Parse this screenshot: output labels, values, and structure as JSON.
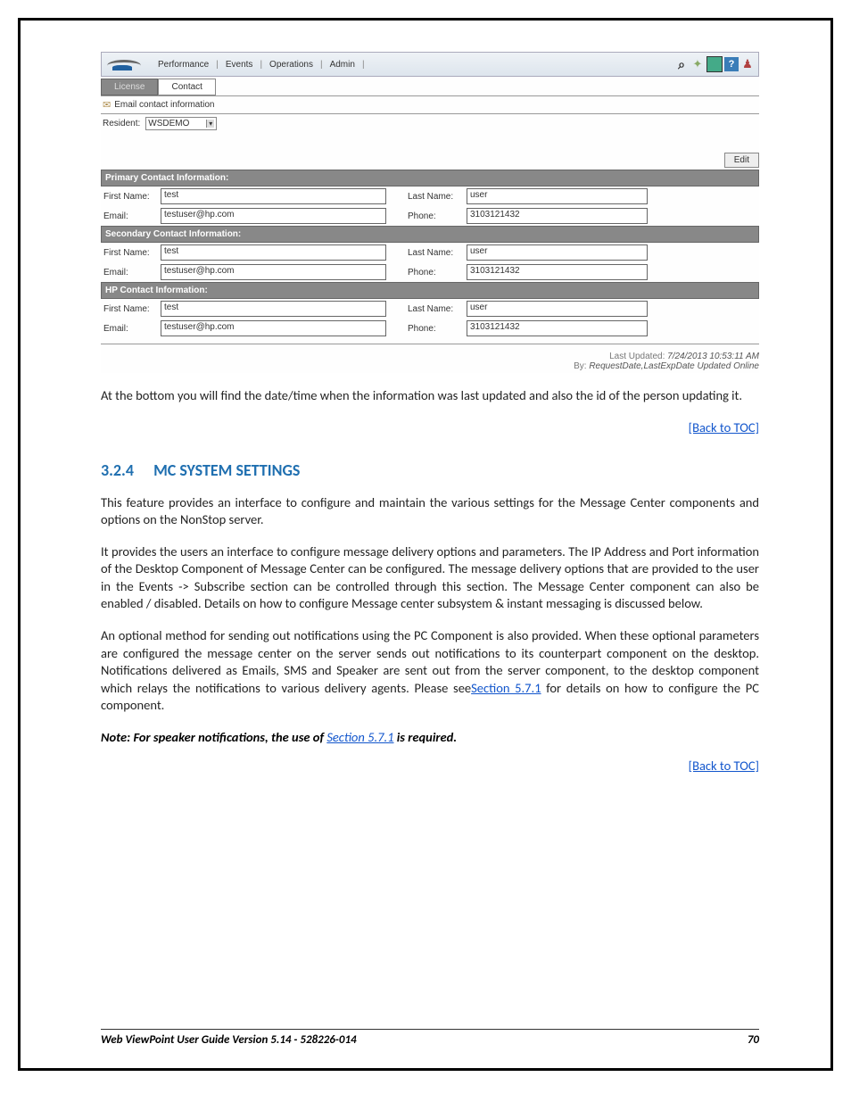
{
  "nav": {
    "items": [
      "Performance",
      "Events",
      "Operations",
      "Admin"
    ]
  },
  "tabs": {
    "license": "License",
    "contact": "Contact"
  },
  "panel": {
    "email_title": "Email contact information",
    "resident_label": "Resident:",
    "resident_value": "WSDEMO",
    "edit_button": "Edit"
  },
  "sections": [
    {
      "header": "Primary Contact Information:",
      "first_name_label": "First Name:",
      "first_name": "test",
      "last_name_label": "Last Name:",
      "last_name": "user",
      "email_label": "Email:",
      "email": "testuser@hp.com",
      "phone_label": "Phone:",
      "phone": "3103121432"
    },
    {
      "header": "Secondary Contact Information:",
      "first_name_label": "First Name:",
      "first_name": "test",
      "last_name_label": "Last Name:",
      "last_name": "user",
      "email_label": "Email:",
      "email": "testuser@hp.com",
      "phone_label": "Phone:",
      "phone": "3103121432"
    },
    {
      "header": "HP Contact Information:",
      "first_name_label": "First Name:",
      "first_name": "test",
      "last_name_label": "Last Name:",
      "last_name": "user",
      "email_label": "Email:",
      "email": "testuser@hp.com",
      "phone_label": "Phone:",
      "phone": "3103121432"
    }
  ],
  "status": {
    "last_updated_label": "Last Updated:",
    "last_updated_value": "7/24/2013 10:53:11 AM",
    "by_label": "By:",
    "by_value": "RequestDate,LastExpDate Updated Online"
  },
  "doc": {
    "p1": "At the bottom you will find the date/time when the information was last updated and also the id of the person updating it.",
    "back_toc": "[Back to TOC]",
    "heading_num": "3.2.4",
    "heading_text": "MC SYSTEM SETTINGS",
    "p2": "This feature provides an interface to configure and maintain the various settings for the Message Center components and options on the NonStop server.",
    "p3_a": "It provides the users an interface to configure message delivery options and parameters. The IP Address and Port information of the Desktop Component of Message Center can be configured. The message delivery options that are provided to the user in the Events -> Subscribe section can be controlled through this section. The Message Center component can also be enabled / disabled. Details on how to configure Message center subsystem & instant messaging is discussed below.",
    "p4_a": "An optional method for sending out notifications using the PC Component is also provided. When these optional parameters are configured the message center on the server sends out notifications to its counterpart component on the desktop. Notifications delivered as Emails, SMS and Speaker are sent out from the server component, to the desktop component which relays the notifications to various delivery agents. Please see",
    "p4_link": "Section 5.7.1",
    "p4_b": " for details on how to configure the PC component.",
    "note_a": "Note: For speaker notifications, the use of ",
    "note_link": "Section 5.7.1",
    "note_b": " is required."
  },
  "footer": {
    "left": "Web ViewPoint User Guide Version 5.14 - 528226-014",
    "right": "70"
  }
}
